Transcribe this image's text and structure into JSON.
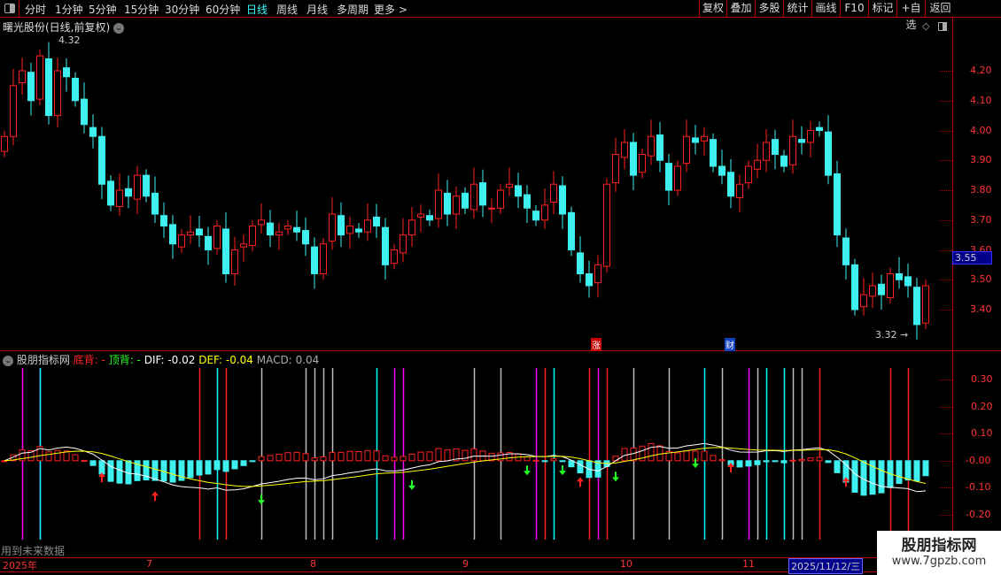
{
  "toolbar": {
    "periods": [
      "分时",
      "1分钟",
      "5分钟",
      "15分钟",
      "30分钟",
      "60分钟",
      "日线",
      "周线",
      "月线",
      "多周期",
      "更多 >"
    ],
    "active_period": "日线",
    "right_buttons": [
      "复权",
      "叠加",
      "多股",
      "统计",
      "画线",
      "F10",
      "标记",
      "+自选",
      "返回"
    ]
  },
  "chart_title": "曙光股份(日线,前复权)",
  "price_axis": [
    "4.20",
    "4.10",
    "4.00",
    "3.90",
    "3.80",
    "3.70",
    "3.60",
    "3.50",
    "3.40"
  ],
  "current_price": "3.55",
  "high_marker": "4.32",
  "low_marker": "3.32",
  "tags": {
    "zhang": "涨",
    "cai": "财"
  },
  "indicator": {
    "name": "股朋指标网",
    "bottom_div": "底背: -",
    "top_div": "顶背: -",
    "dif": "DIF: -0.02",
    "def": "DEF: -0.04",
    "macd": "MACD: 0.04"
  },
  "macd_axis": [
    "0.30",
    "0.20",
    "0.10",
    "-0.00",
    "-0.10",
    "-0.20"
  ],
  "future_note": "用到未来数据",
  "date_axis": [
    "2025年",
    "7",
    "8",
    "9",
    "10",
    "11"
  ],
  "current_date": "2025/11/12/三",
  "watermark": {
    "name": "股朋指标网",
    "url": "www.7gpzb.com"
  },
  "colors": {
    "up": "#ff2020",
    "down": "#3ff0f0",
    "dif": "#ffffff",
    "dea": "#ffff00",
    "accent": "#b00000"
  },
  "candles_close": [
    3.98,
    4.15,
    4.2,
    4.1,
    4.25,
    4.05,
    4.2,
    4.18,
    4.1,
    4.02,
    3.98,
    3.82,
    3.75,
    3.8,
    3.78,
    3.85,
    3.78,
    3.72,
    3.68,
    3.62,
    3.65,
    3.66,
    3.65,
    3.6,
    3.68,
    3.52,
    3.6,
    3.62,
    3.68,
    3.7,
    3.65,
    3.66,
    3.68,
    3.66,
    3.62,
    3.52,
    3.62,
    3.72,
    3.65,
    3.68,
    3.66,
    3.7,
    3.68,
    3.55,
    3.6,
    3.65,
    3.7,
    3.72,
    3.7,
    3.8,
    3.72,
    3.78,
    3.74,
    3.82,
    3.75,
    3.74,
    3.8,
    3.82,
    3.78,
    3.74,
    3.7,
    3.75,
    3.82,
    3.72,
    3.6,
    3.52,
    3.48,
    3.55,
    3.82,
    3.92,
    3.96,
    3.85,
    3.92,
    3.98,
    3.9,
    3.8,
    3.88,
    3.98,
    3.96,
    3.98,
    3.88,
    3.85,
    3.78,
    3.82,
    3.88,
    3.9,
    3.96,
    3.92,
    3.88,
    3.98,
    3.96,
    4.0,
    4.0,
    3.85,
    3.65,
    3.55,
    3.4,
    3.45,
    3.48,
    3.45,
    3.52,
    3.5,
    3.48,
    3.35,
    3.48
  ],
  "signal_lines": {
    "magenta": [
      2,
      4,
      44,
      45,
      60,
      67,
      84
    ],
    "cyan": [
      4,
      24,
      42,
      62,
      79,
      86,
      88
    ],
    "red": [
      22,
      25,
      61,
      66,
      68,
      92,
      100,
      102
    ],
    "grey": [
      29,
      34,
      35,
      36,
      37,
      53,
      56,
      71,
      75,
      81,
      85,
      89,
      90
    ]
  },
  "arrows_up": [
    11,
    17,
    65,
    82,
    95
  ],
  "arrows_down": [
    29,
    46,
    59,
    63,
    69,
    78
  ]
}
